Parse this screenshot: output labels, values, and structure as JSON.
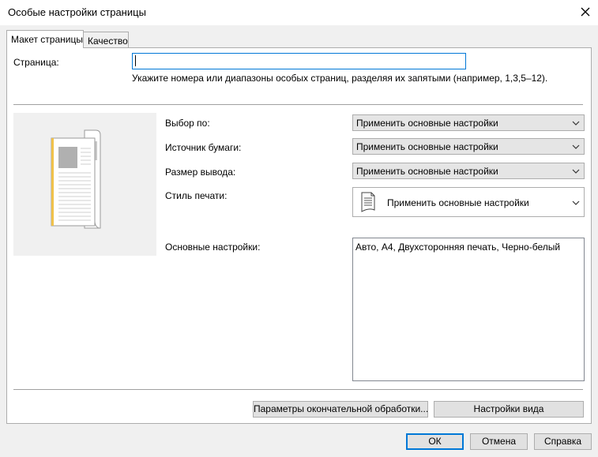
{
  "window": {
    "title": "Особые настройки страницы"
  },
  "tabs": [
    {
      "label": "Макет страницы",
      "active": true
    },
    {
      "label": "Качество",
      "active": false
    }
  ],
  "page_field": {
    "label": "Страница:",
    "value": "",
    "hint": "Укажите номера или диапазоны особых страниц, разделяя их запятыми (например, 1,3,5–12)."
  },
  "form": {
    "select_by": {
      "label": "Выбор по:",
      "value": "Применить основные настройки"
    },
    "paper_source": {
      "label": "Источник бумаги:",
      "value": "Применить основные настройки"
    },
    "output_size": {
      "label": "Размер вывода:",
      "value": "Применить основные настройки"
    },
    "print_style": {
      "label": "Стиль печати:",
      "value": "Применить основные настройки"
    },
    "basic_settings": {
      "label": "Основные настройки:",
      "value": "Авто, A4, Двухсторонняя печать, Черно-белый"
    }
  },
  "panel_buttons": {
    "finishing": "Параметры окончательной обработки...",
    "view_settings": "Настройки вида"
  },
  "dialog_buttons": {
    "ok": "ОК",
    "cancel": "Отмена",
    "help": "Справка"
  }
}
